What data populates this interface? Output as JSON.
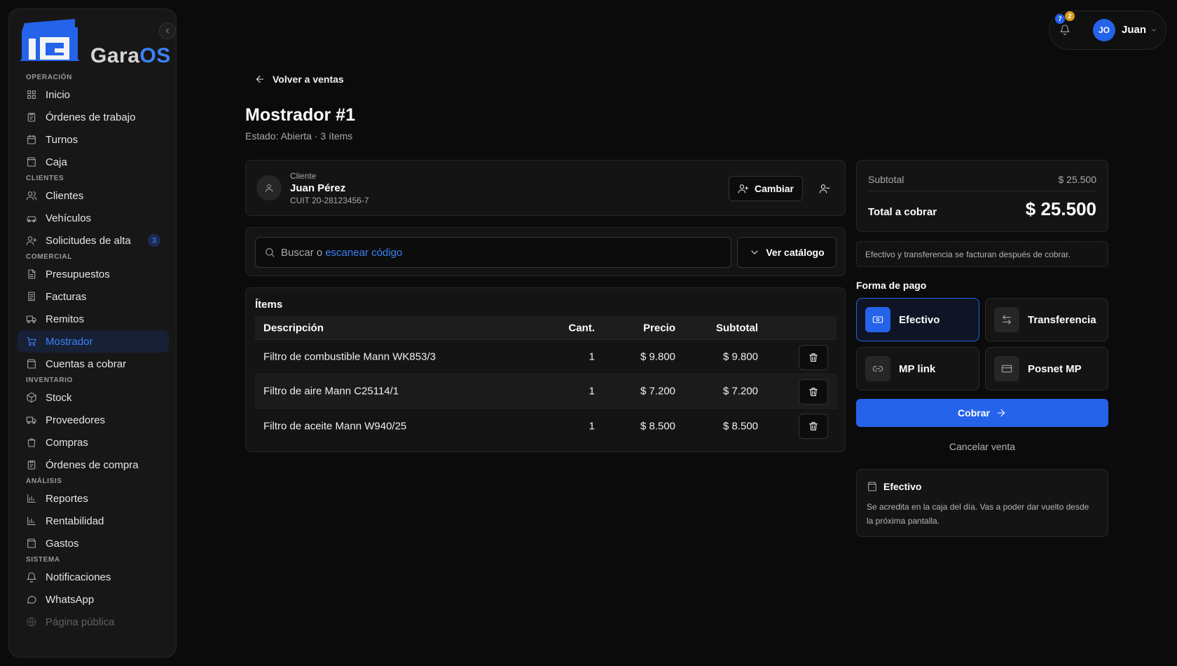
{
  "brand": {
    "name_prefix": "Gara",
    "name_suffix": "OS"
  },
  "sidebar": {
    "sections": [
      {
        "label": "OPERACIÓN",
        "items": [
          {
            "label": "Inicio",
            "icon": "grid-icon"
          },
          {
            "label": "Órdenes de trabajo",
            "icon": "clipboard-icon"
          },
          {
            "label": "Turnos",
            "icon": "calendar-icon"
          },
          {
            "label": "Caja",
            "icon": "wallet-icon"
          }
        ]
      },
      {
        "label": "CLIENTES",
        "items": [
          {
            "label": "Clientes",
            "icon": "users-icon"
          },
          {
            "label": "Vehículos",
            "icon": "car-icon"
          },
          {
            "label": "Solicitudes de alta",
            "icon": "user-plus-icon",
            "badge": "3"
          }
        ]
      },
      {
        "label": "COMERCIAL",
        "items": [
          {
            "label": "Presupuestos",
            "icon": "file-text-icon"
          },
          {
            "label": "Facturas",
            "icon": "receipt-icon"
          },
          {
            "label": "Remitos",
            "icon": "truck-icon"
          },
          {
            "label": "Mostrador",
            "icon": "cart-icon",
            "active": true
          },
          {
            "label": "Cuentas a cobrar",
            "icon": "wallet-icon"
          }
        ]
      },
      {
        "label": "INVENTARIO",
        "items": [
          {
            "label": "Stock",
            "icon": "box-icon"
          },
          {
            "label": "Proveedores",
            "icon": "truck-icon"
          },
          {
            "label": "Compras",
            "icon": "shopping-bag-icon"
          },
          {
            "label": "Órdenes de compra",
            "icon": "clipboard-icon"
          }
        ]
      },
      {
        "label": "ANÁLISIS",
        "items": [
          {
            "label": "Reportes",
            "icon": "bar-chart-icon"
          },
          {
            "label": "Rentabilidad",
            "icon": "bar-chart-icon"
          },
          {
            "label": "Gastos",
            "icon": "wallet-icon"
          }
        ]
      },
      {
        "label": "SISTEMA",
        "items": [
          {
            "label": "Notificaciones",
            "icon": "bell-icon"
          },
          {
            "label": "WhatsApp",
            "icon": "message-icon"
          },
          {
            "label": "Página pública",
            "icon": "globe-icon",
            "faded": true
          }
        ]
      }
    ]
  },
  "topbar": {
    "notif_count_blue": "7",
    "notif_count_amber": "2",
    "user_initials": "JO",
    "user_name": "Juan"
  },
  "page": {
    "back_label": "Volver a ventas",
    "title": "Mostrador #1",
    "subtitle": "Estado: Abierta · 3 ítems"
  },
  "client": {
    "label": "Cliente",
    "name": "Juan Pérez",
    "cuit": "CUIT 20-28123456-7",
    "change_label": "Cambiar"
  },
  "search": {
    "prefix": "Buscar o",
    "link": "escanear código",
    "catalog_label": "Ver catálogo"
  },
  "items": {
    "title": "Ítems",
    "columns": {
      "desc": "Descripción",
      "qty": "Cant.",
      "price": "Precio",
      "subtotal": "Subtotal"
    },
    "rows": [
      {
        "desc": "Filtro de combustible Mann WK853/3",
        "qty": "1",
        "price": "$ 9.800",
        "subtotal": "$ 9.800"
      },
      {
        "desc": "Filtro de aire Mann C25114/1",
        "qty": "1",
        "price": "$ 7.200",
        "subtotal": "$ 7.200"
      },
      {
        "desc": "Filtro de aceite Mann W940/25",
        "qty": "1",
        "price": "$ 8.500",
        "subtotal": "$ 8.500"
      }
    ]
  },
  "totals": {
    "subtotal_label": "Subtotal",
    "subtotal_value": "$ 25.500",
    "total_label": "Total a cobrar",
    "total_value": "$ 25.500"
  },
  "note": "Efectivo y transferencia se facturan después de cobrar.",
  "payment": {
    "title": "Forma de pago",
    "methods": [
      {
        "label": "Efectivo",
        "icon": "cash-icon",
        "selected": true
      },
      {
        "label": "Transferencia",
        "icon": "transfer-icon"
      },
      {
        "label": "MP link",
        "icon": "link-icon"
      },
      {
        "label": "Posnet MP",
        "icon": "card-icon"
      }
    ],
    "charge_label": "Cobrar",
    "cancel_label": "Cancelar venta"
  },
  "info": {
    "title": "Efectivo",
    "text": "Se acredita en la caja del día. Vas a poder dar vuelto desde la próxima pantalla."
  },
  "colors": {
    "accent": "#2563eb",
    "accent_text": "#3b82f6",
    "background": "#0b0b0b",
    "card": "#141414"
  }
}
